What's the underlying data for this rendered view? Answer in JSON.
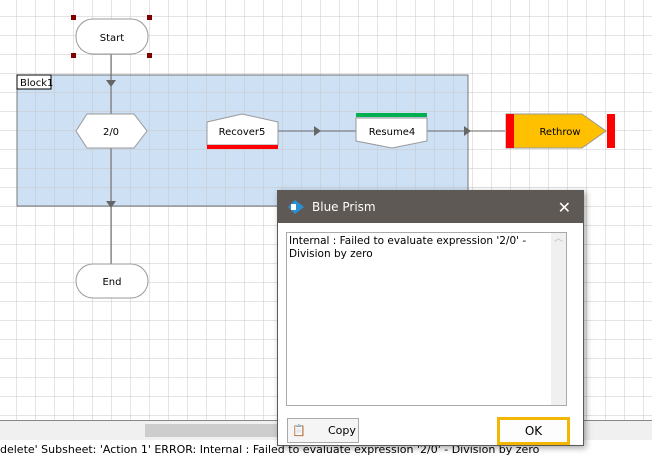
{
  "diagram": {
    "block_label": "Block1",
    "nodes": {
      "start": "Start",
      "calc": "2/0",
      "recover": "Recover5",
      "resume": "Resume4",
      "rethrow": "Rethrow",
      "end": "End"
    },
    "colors": {
      "block": "#cde0f4",
      "rethrow": "#ffc000",
      "error_bar": "#ff0000",
      "resume_bar": "#00b050"
    }
  },
  "status_bar": "delete' Subsheet: 'Action 1' ERROR: Internal : Failed to evaluate expression '2/0' - Division by zero",
  "dialog": {
    "title": "Blue Prism",
    "message": "Internal : Failed to evaluate expression '2/0' - Division by zero",
    "copy_label": "Copy",
    "ok_label": "OK"
  }
}
